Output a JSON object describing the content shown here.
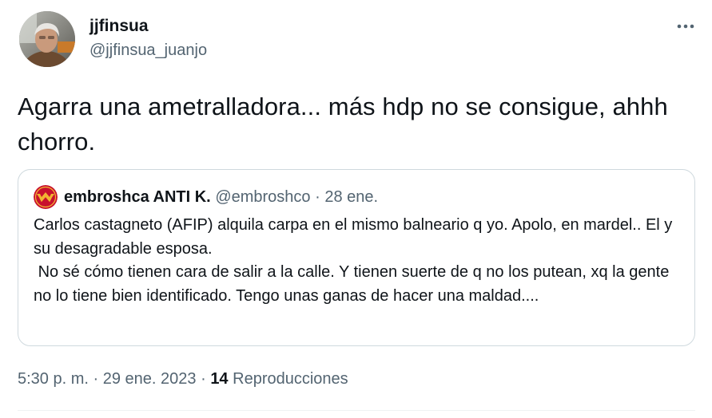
{
  "author": {
    "name": "jjfinsua",
    "handle": "@jjfinsua_juanjo"
  },
  "tweet": {
    "text": "Agarra una ametralladora... más hdp no se consigue, ahhh chorro."
  },
  "quote": {
    "name": "embroshca ANTI K.",
    "handle": "@embroshco",
    "separator": "·",
    "date": "28 ene.",
    "text": "Carlos castagneto (AFIP) alquila carpa en el mismo balneario q yo. Apolo, en mardel.. El y su desagradable esposa.\n No sé cómo tienen cara de salir a la calle. Y tienen suerte de q no los putean, xq la gente no lo tiene bien identificado. Tengo unas ganas de hacer una maldad...."
  },
  "meta": {
    "time": "5:30 p. m.",
    "sep1": "·",
    "date": "29 ene. 2023",
    "sep2": "·",
    "views_count": "14",
    "views_label": "Reproducciones"
  },
  "icons": {
    "more": "more-horizontal-icon",
    "quote_avatar": "wonder-woman-logo-icon"
  },
  "colors": {
    "text_primary": "#0f1419",
    "text_secondary": "#536471",
    "border": "#cfd9de",
    "quote_avatar_red": "#c8102e",
    "quote_avatar_gold": "#f2b632"
  }
}
